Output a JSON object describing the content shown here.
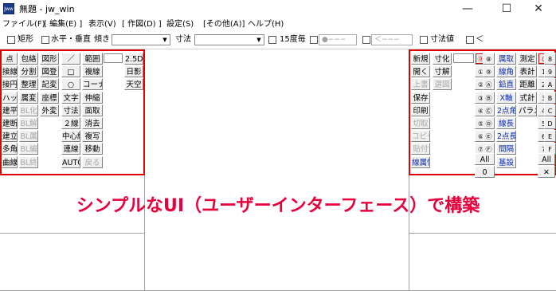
{
  "window": {
    "title": "無題 - jw_win",
    "app_icon_text": "Jww",
    "minimize_glyph": "—",
    "maximize_glyph": "☐",
    "close_glyph": "✕"
  },
  "menu": [
    "ファイル(F)",
    "[ 編集(E) ]",
    "表示(V)",
    "[ 作図(D) ]",
    "設定(S)",
    "[その他(A)]",
    "ヘルプ(H)"
  ],
  "toolbar": {
    "rect_label": "矩形",
    "hv_label": "水平・垂直",
    "slope_label": "傾き",
    "dim_label": "寸法",
    "deg15_label": "15度毎",
    "point_placeholder": "●−−−",
    "arrow_placeholder": "＜−−−",
    "dimval_label": "寸法値",
    "lt_label": "＜"
  },
  "left_panel": {
    "col1": [
      "点",
      "接線",
      "接円",
      "ハッチ",
      "建平",
      "建断",
      "建立",
      "多角形",
      "曲線"
    ],
    "col2": [
      "包絡",
      "分割",
      "整理",
      "属変",
      "BL化",
      "BL解",
      "BL属",
      "BL編",
      "BL終"
    ],
    "col2_disabled": [
      false,
      false,
      false,
      false,
      true,
      true,
      true,
      true,
      true
    ],
    "col3": [
      "図形",
      "図登",
      "記変",
      "座標",
      "外変"
    ],
    "col4": [
      "／",
      "□",
      "○",
      "文字",
      "寸法",
      "２線",
      "中心線",
      "連線",
      "AUTO"
    ],
    "col5": [
      "範囲",
      "複線",
      "コーナー",
      "伸縮",
      "面取",
      "消去",
      "複写",
      "移動",
      "戻る"
    ],
    "col5_disabled": [
      false,
      false,
      false,
      false,
      false,
      false,
      false,
      false,
      true
    ],
    "col6": [
      "2.5D",
      "日影",
      "天空"
    ]
  },
  "right_panel": {
    "colA": [
      "新規",
      "開く",
      "上書",
      "保存",
      "印刷",
      "切取",
      "コピー",
      "貼付",
      "線属性"
    ],
    "colA_disabled": [
      false,
      false,
      true,
      false,
      false,
      true,
      true,
      true,
      false
    ],
    "colB": [
      "寸化",
      "寸解",
      "選図"
    ],
    "colB_disabled": [
      false,
      false,
      true
    ],
    "layer_circles": [
      "⓪",
      "①",
      "②",
      "③",
      "④",
      "⑤",
      "⑥",
      "⑦"
    ],
    "layer_circles2": [
      "⑧",
      "⑨",
      "Ⓐ",
      "Ⓑ",
      "Ⓒ",
      "Ⓓ",
      "Ⓔ",
      "Ⓕ"
    ],
    "layer_all": "All",
    "layer_num": "0",
    "colC": [
      "属取",
      "線角",
      "鉛直",
      "X軸",
      "2点角",
      "線長",
      "2点長",
      "間隔",
      "基設"
    ],
    "colD": [
      "測定",
      "表計",
      "距離",
      "式計",
      "パラメ"
    ],
    "group_circles": [
      "0",
      "1",
      "2",
      "3",
      "4",
      "5",
      "6",
      "7"
    ],
    "group_circles2": [
      "8",
      "9",
      "A",
      "B",
      "C",
      "D",
      "E",
      "F"
    ],
    "group_all": "All",
    "group_x": "✕"
  },
  "caption": "シンプルなUI（ユーザーインターフェース）で構築",
  "colors": {
    "caption": "#e8003c",
    "frame": "#e00000",
    "blue_text": "#0a2ab0"
  }
}
